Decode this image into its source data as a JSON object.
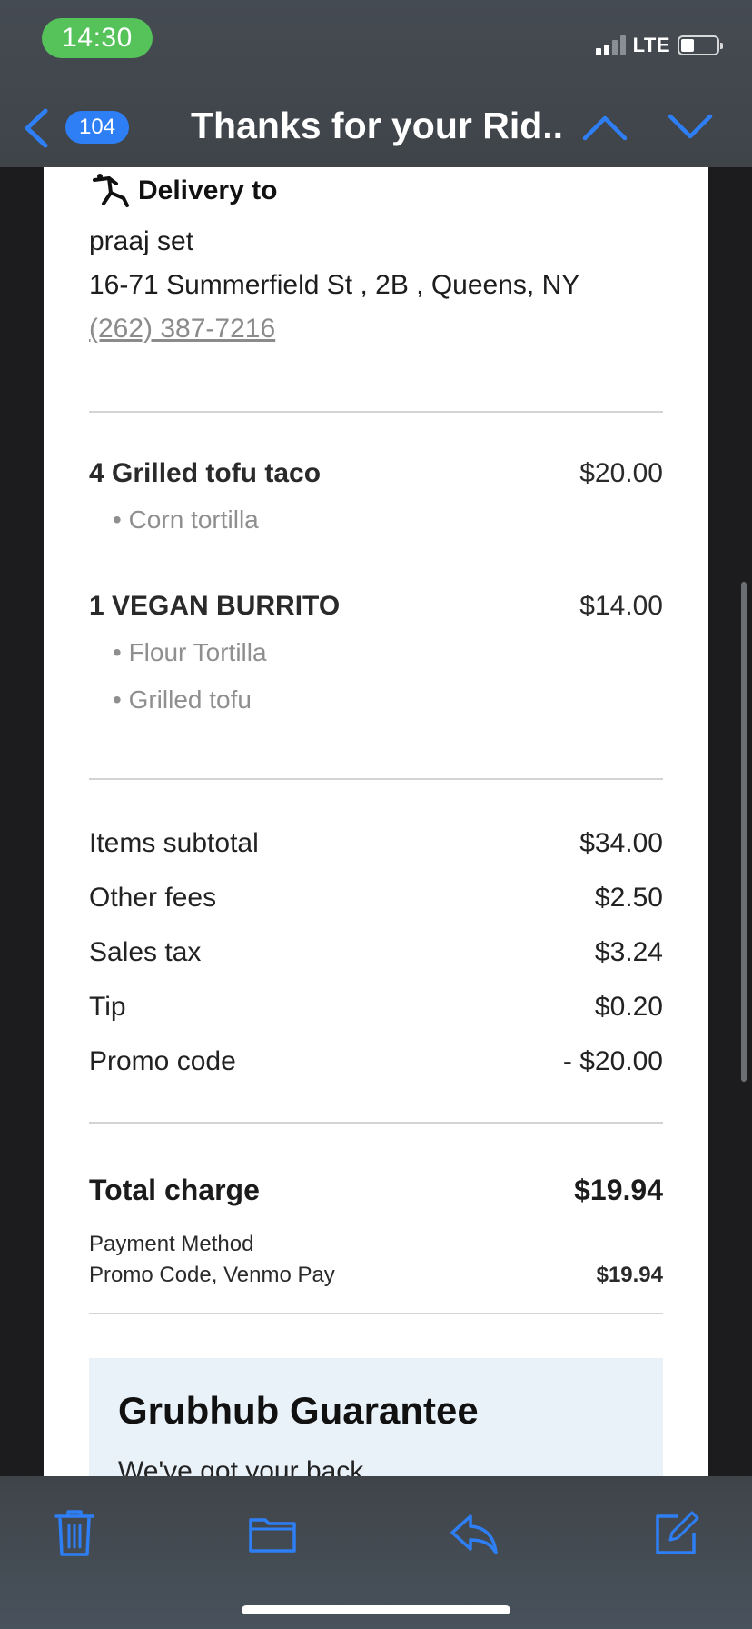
{
  "status_bar": {
    "time": "14:30",
    "network": "LTE"
  },
  "nav": {
    "unread_count": "104",
    "title": "Thanks for your Rid...",
    "icons": [
      "chevron-left-icon",
      "chevron-up-icon",
      "chevron-down-icon"
    ],
    "accent_color": "#2e7ff5"
  },
  "delivery": {
    "heading": "Delivery to",
    "name": "praaj set",
    "address": "16-71 Summerfield St , 2B , Queens, NY",
    "phone": "(262) 387-7216"
  },
  "items": [
    {
      "name": "4 Grilled tofu taco",
      "price": "$20.00",
      "modifiers": [
        "• Corn tortilla"
      ]
    },
    {
      "name": "1 VEGAN BURRITO",
      "price": "$14.00",
      "modifiers": [
        "• Flour Tortilla",
        "• Grilled tofu"
      ]
    }
  ],
  "summary": [
    {
      "label": "Items subtotal",
      "value": "$34.00"
    },
    {
      "label": "Other fees",
      "value": "$2.50"
    },
    {
      "label": "Sales tax",
      "value": "$3.24"
    },
    {
      "label": "Tip",
      "value": "$0.20"
    },
    {
      "label": "Promo code",
      "value": "- $20.00"
    }
  ],
  "total": {
    "label": "Total charge",
    "value": "$19.94"
  },
  "payment": {
    "label": "Payment Method",
    "method": "Promo Code, Venmo Pay",
    "amount": "$19.94"
  },
  "guarantee": {
    "title": "Grubhub Guarantee",
    "subtitle": "We've got your back"
  },
  "toolbar": {
    "icons": [
      "trash-icon",
      "folder-icon",
      "reply-icon",
      "compose-icon"
    ]
  }
}
